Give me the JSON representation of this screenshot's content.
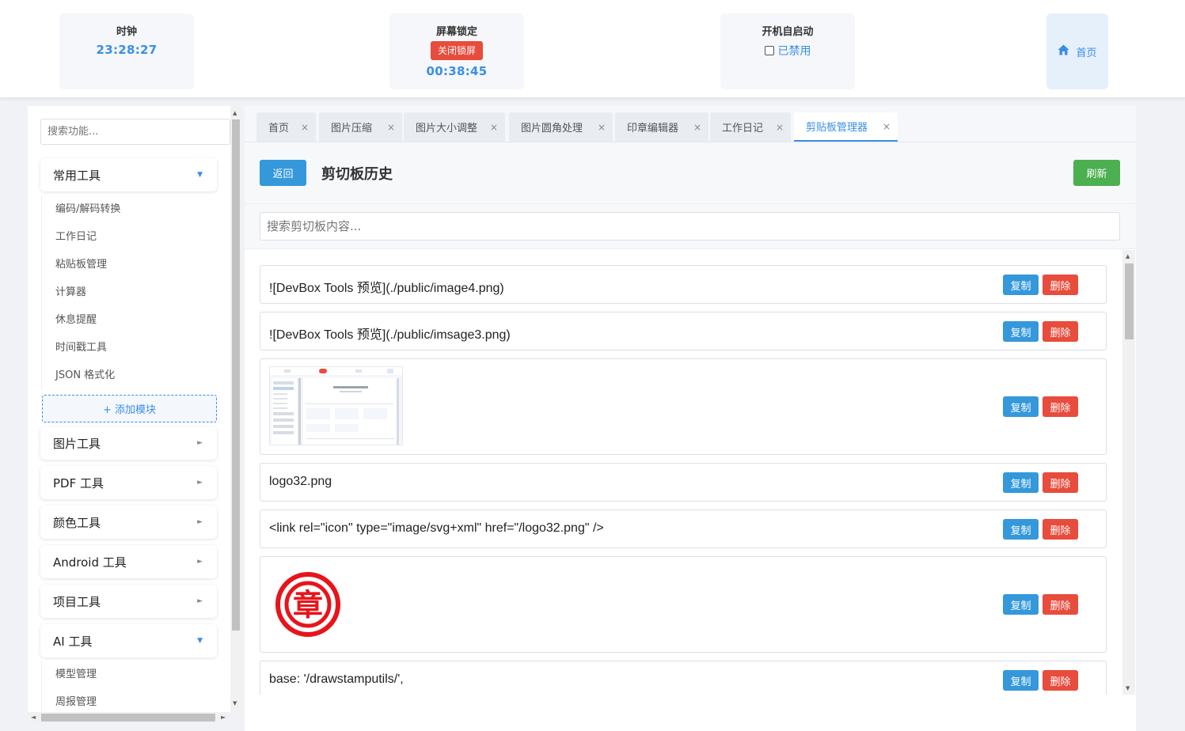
{
  "topbar": {
    "clock": {
      "label": "时钟",
      "time": "23:28:27"
    },
    "screen_lock": {
      "label": "屏幕锁定",
      "button": "关闭锁屏",
      "time": "00:38:45"
    },
    "autostart": {
      "label": "开机自启动",
      "status": "已禁用",
      "checked": false
    },
    "home": {
      "label": "首页",
      "icon": "home-icon"
    }
  },
  "sidebar": {
    "search_placeholder": "搜索功能...",
    "groups": [
      {
        "label": "常用工具",
        "expanded": true,
        "items": [
          "编码/解码转换",
          "工作日记",
          "粘贴板管理",
          "计算器",
          "休息提醒",
          "时间戳工具",
          "JSON 格式化"
        ]
      },
      {
        "label": "图片工具",
        "expanded": false
      },
      {
        "label": "PDF 工具",
        "expanded": false
      },
      {
        "label": "颜色工具",
        "expanded": false
      },
      {
        "label": "Android 工具",
        "expanded": false
      },
      {
        "label": "项目工具",
        "expanded": false
      },
      {
        "label": "AI 工具",
        "expanded": true,
        "items": [
          "模型管理",
          "周报管理"
        ]
      }
    ],
    "add_module": "+ 添加模块",
    "arrow_collapsed": "►",
    "arrow_expanded": "▼"
  },
  "tabs": [
    {
      "label": "首页",
      "active": false
    },
    {
      "label": "图片压缩",
      "active": false
    },
    {
      "label": "图片大小调整",
      "active": false
    },
    {
      "label": "图片圆角处理",
      "active": false
    },
    {
      "label": "印章编辑器",
      "active": false
    },
    {
      "label": "工作日记",
      "active": false
    },
    {
      "label": "剪贴板管理器",
      "active": true
    }
  ],
  "tab_close": "×",
  "clipboard": {
    "back": "返回",
    "title": "剪切板历史",
    "refresh": "刷新",
    "search_placeholder": "搜索剪切板内容...",
    "copy_label": "复制",
    "delete_label": "删除",
    "items": [
      {
        "type": "text",
        "content": "![DevBox Tools 预览](./public/image4.png)"
      },
      {
        "type": "text",
        "content": "![DevBox Tools 预览](./public/imsage3.png)"
      },
      {
        "type": "image",
        "content": "screenshot-thumbnail"
      },
      {
        "type": "text",
        "content": "logo32.png"
      },
      {
        "type": "text",
        "content": "<link rel=\"icon\" type=\"image/svg+xml\" href=\"/logo32.png\" />"
      },
      {
        "type": "image",
        "content": "stamp-image",
        "stamp_char": "章"
      },
      {
        "type": "text",
        "content": "base: '/drawstamputils/',"
      }
    ]
  },
  "colors": {
    "accent": "#3a8ee6",
    "primary_button": "#3498db",
    "danger": "#e74c3c",
    "success": "#4caf50",
    "stamp_red": "#e8141b"
  }
}
